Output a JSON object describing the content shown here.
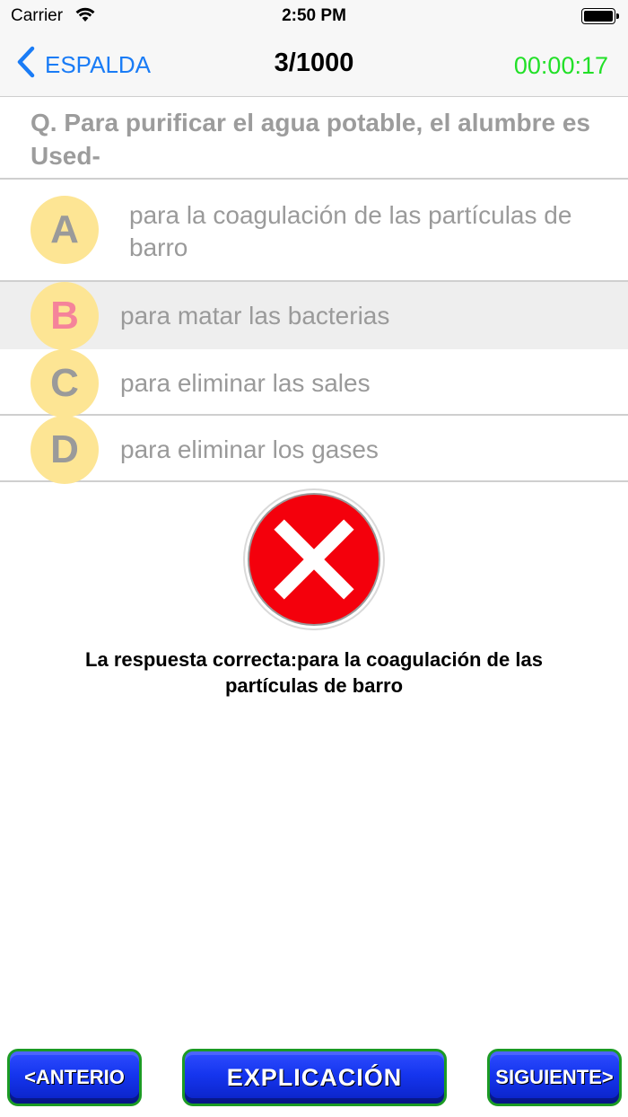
{
  "status_bar": {
    "carrier": "Carrier",
    "time": "2:50 PM",
    "icons": [
      "wifi-icon",
      "battery-icon"
    ]
  },
  "nav": {
    "back_label": "ESPALDA",
    "title": "3/1000",
    "timer": "00:00:17",
    "colors": {
      "back": "#1a7cf6",
      "timer": "#22e028"
    }
  },
  "question": "Q. Para purificar el agua potable, el alumbre es Used-",
  "options": [
    {
      "letter": "A",
      "text": "para la coagulación de las partículas de barro"
    },
    {
      "letter": "B",
      "text": "para matar las bacterias"
    },
    {
      "letter": "C",
      "text": "para eliminar las sales"
    },
    {
      "letter": "D",
      "text": "para eliminar los gases"
    }
  ],
  "selected_option": "B",
  "result": {
    "icon": "wrong-x-icon",
    "answer_text": "La respuesta correcta:para la coagulación de las partículas de barro"
  },
  "buttons": {
    "prev": "<ANTERIO",
    "explain": "EXPLICACIÓN",
    "next": "SIGUIENTE>"
  }
}
